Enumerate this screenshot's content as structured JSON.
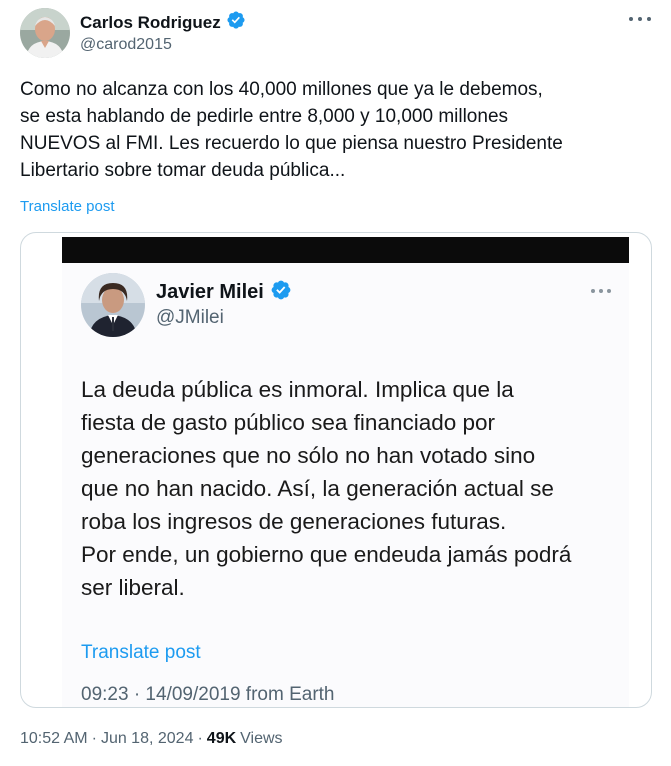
{
  "author": {
    "name": "Carlos Rodriguez",
    "handle": "@carod2015",
    "verified": true
  },
  "post": {
    "lines": [
      "Como no alcanza con los 40,000 millones que ya le debemos,",
      "se esta hablando de pedirle entre 8,000 y 10,000 millones",
      "NUEVOS al FMI. Les recuerdo lo que piensa nuestro Presidente",
      "Libertario sobre tomar deuda pública..."
    ],
    "translate_label": "Translate post"
  },
  "embedded": {
    "name": "Javier Milei",
    "handle": "@JMilei",
    "verified": true,
    "lines": [
      "La deuda pública es inmoral. Implica que la",
      "fiesta de gasto público sea financiado por",
      "generaciones que no sólo no han votado sino",
      "que no han nacido. Así, la generación actual se",
      "roba los ingresos de generaciones futuras.",
      "Por ende, un gobierno que endeuda jamás podrá",
      "ser liberal."
    ],
    "translate_label": "Translate post",
    "meta": "09:23 · 14/09/2019 from Earth"
  },
  "footer": {
    "time": "10:52 AM",
    "date": "Jun 18, 2024",
    "views_count": "49K",
    "views_label": "Views"
  },
  "colors": {
    "accent": "#1d9bf0",
    "secondary_text": "#536471",
    "primary_text": "#0f1419",
    "border": "#cfd9de"
  },
  "icons": [
    "more-icon",
    "verified-badge-icon",
    "avatar"
  ]
}
